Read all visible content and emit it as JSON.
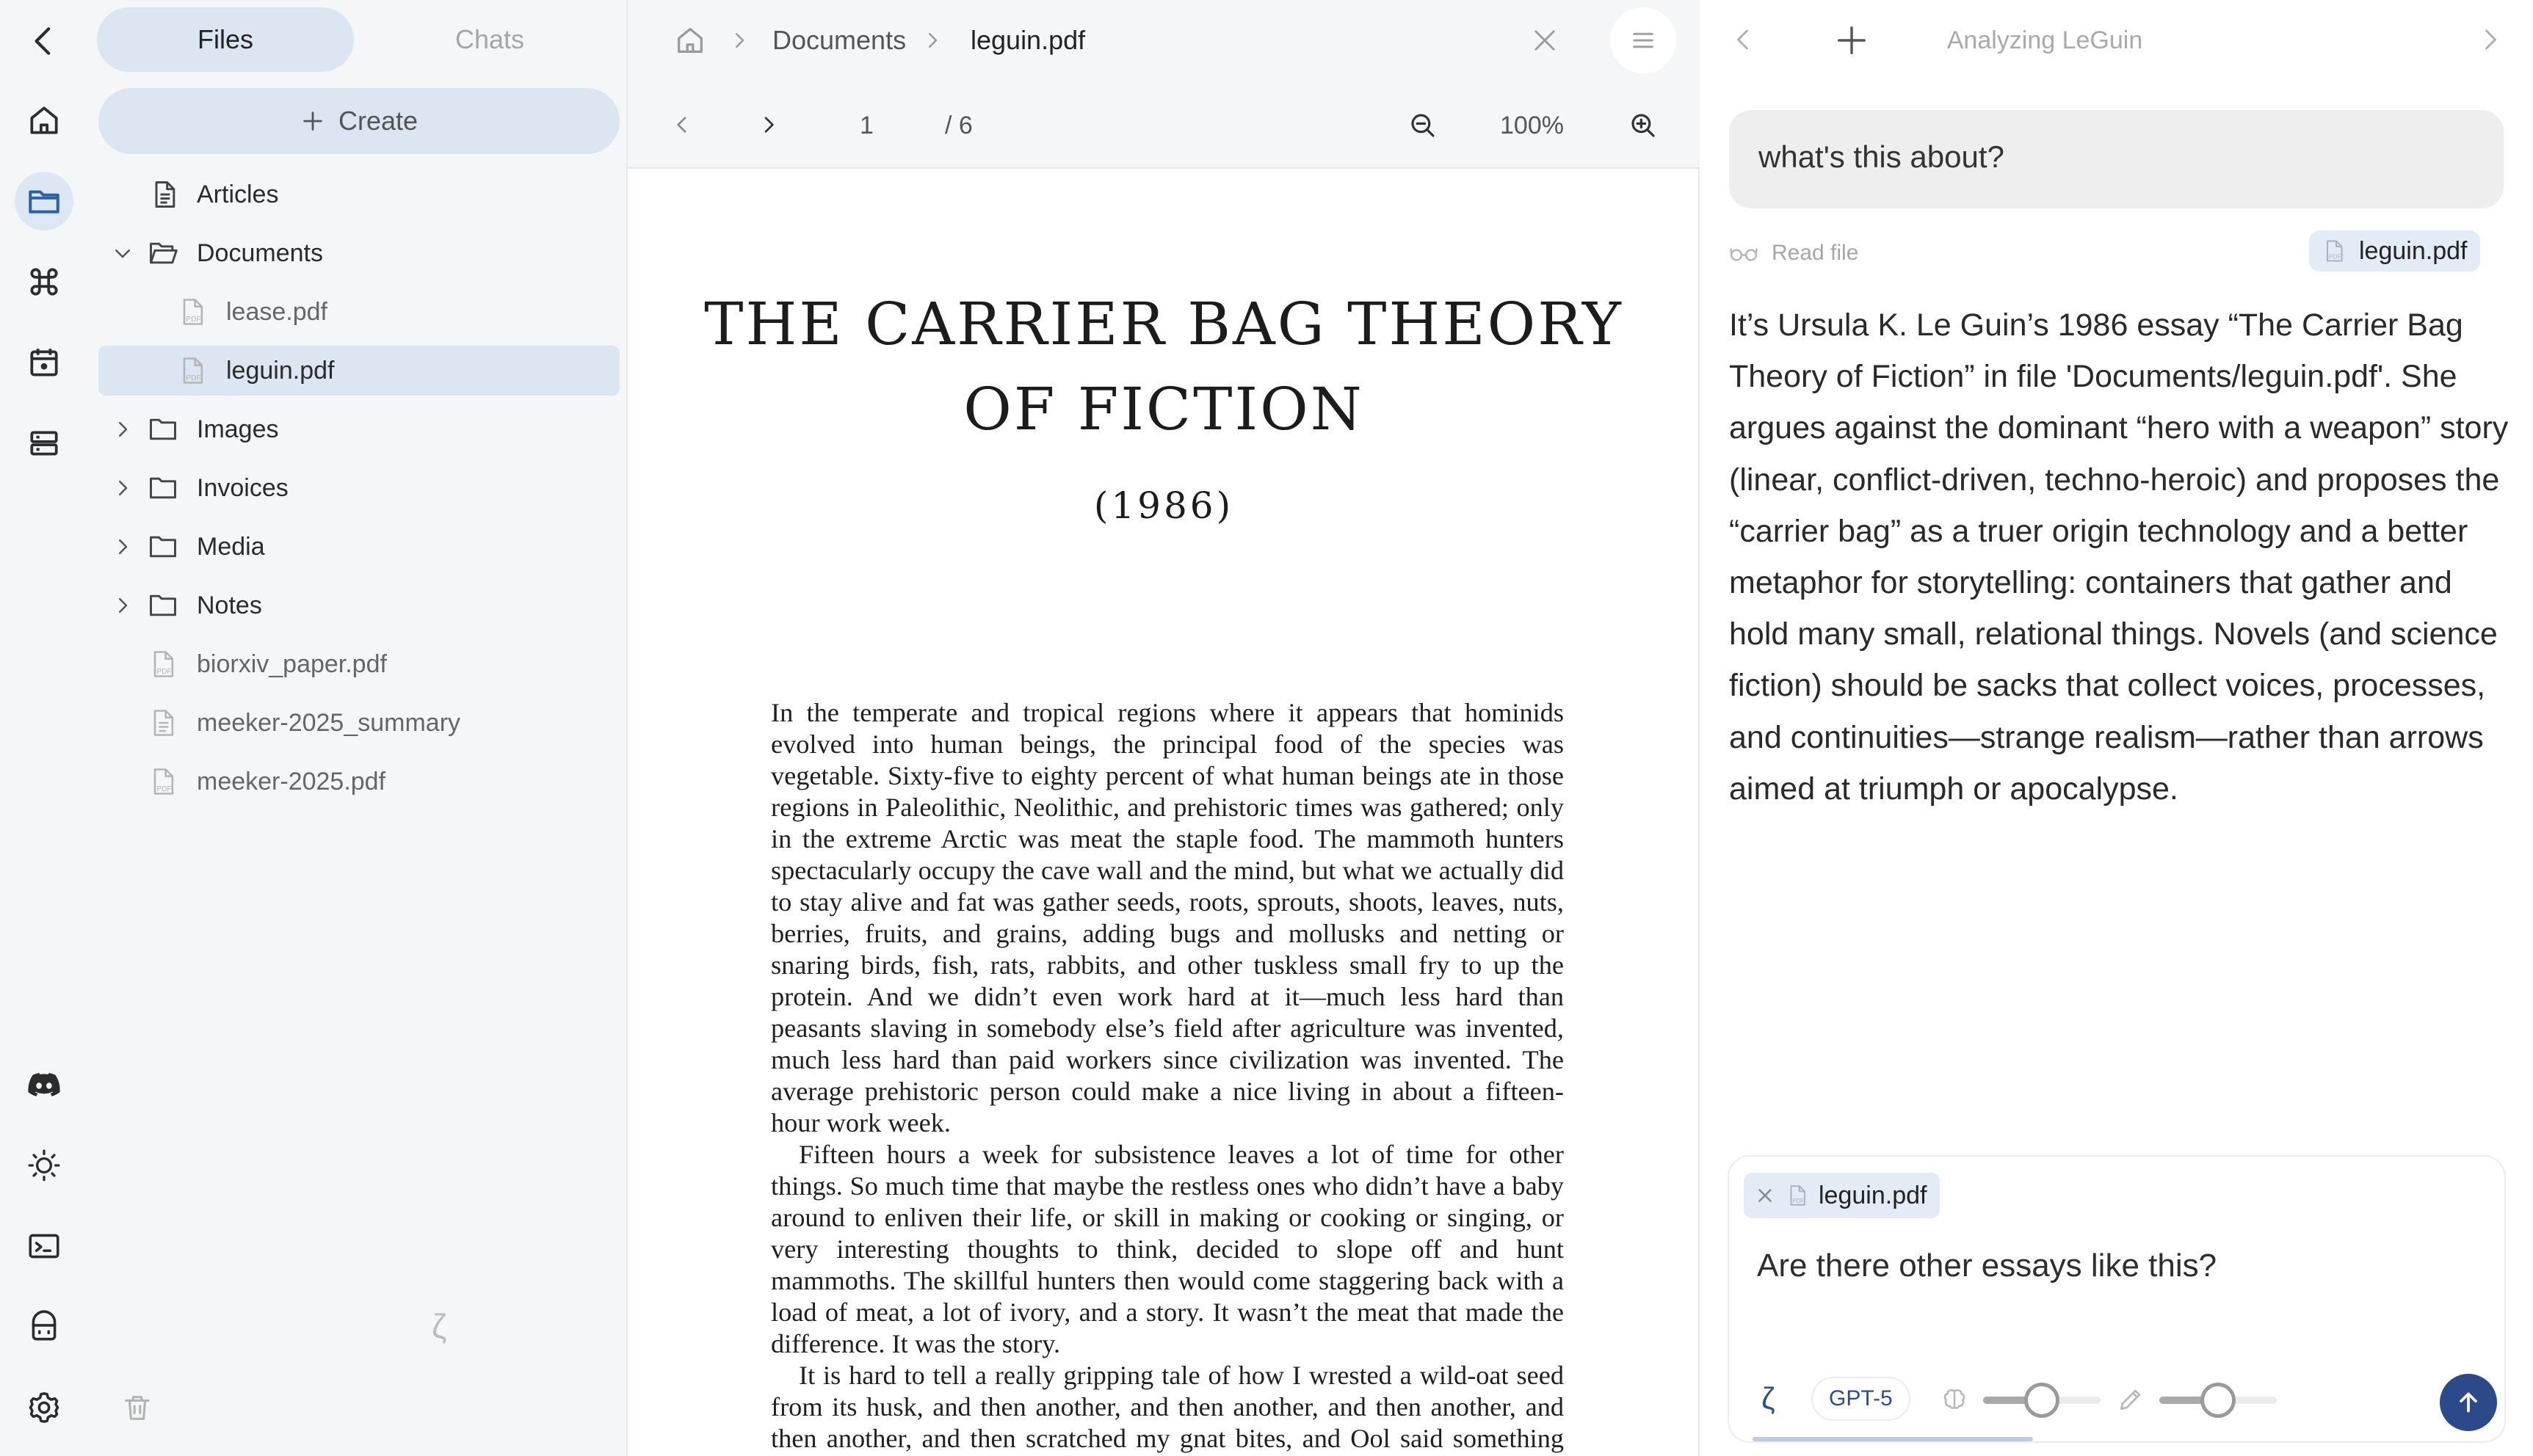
{
  "sidebar": {
    "tabs": {
      "files": "Files",
      "chats": "Chats"
    },
    "create_label": "Create",
    "tree": {
      "articles": "Articles",
      "documents": "Documents",
      "lease": "lease.pdf",
      "leguin": "leguin.pdf",
      "images": "Images",
      "invoices": "Invoices",
      "media": "Media",
      "notes": "Notes",
      "biorxiv": "biorxiv_paper.pdf",
      "meeker_summary": "meeker-2025_summary",
      "meeker_pdf": "meeker-2025.pdf"
    },
    "spinner_glyph": "ζ"
  },
  "viewer": {
    "breadcrumb": {
      "documents": "Documents",
      "file": "leguin.pdf"
    },
    "toolbar": {
      "page": "1",
      "page_total": "/ 6",
      "zoom": "100%"
    },
    "document": {
      "title_line1": "THE CARRIER BAG THEORY",
      "title_line2": "OF FICTION",
      "year": "(1986)",
      "paragraph1": "In the temperate and tropical regions where it appears that hominids evolved into human beings, the principal food of the species was vegetable. Sixty-five to eighty percent of what human beings ate in those regions in Paleolithic, Neolithic, and prehistoric times was gathered; only in the extreme Arctic was meat the staple food. The mammoth hunters spectacularly occupy the cave wall and the mind, but what we actually did to stay alive and fat was gather seeds, roots, sprouts, shoots, leaves, nuts, berries, fruits, and grains, adding bugs and mollusks and netting or snaring birds, fish, rats, rabbits, and other tuskless small fry to up the protein. And we didn’t even work hard at it—much less hard than peasants slaving in somebody else’s field after agriculture was invented, much less hard than paid workers since civilization was invented. The average prehistoric person could make a nice living in about a fifteen-hour work week.",
      "paragraph2": "Fifteen hours a week for subsistence leaves a lot of time for other things. So much time that maybe the restless ones who didn’t have a baby around to enliven their life, or skill in making or cooking or singing, or very interesting thoughts to think, decided to slope off and hunt mammoths. The skillful hunters then would come staggering back with a load of meat, a lot of ivory, and a story. It wasn’t the meat that made the difference. It was the story.",
      "paragraph3": "It is hard to tell a really gripping tale of how I wrested a wild-oat seed from its husk, and then another, and then another, and then another, and then another, and then scratched my gnat bites, and Ool said something funny, and we went to the creek and got a drink and watched newts for a while, and then I found another patch of oats."
    }
  },
  "chat": {
    "title": "Analyzing LeGuin",
    "user_message": "what's this about?",
    "tool_label": "Read file",
    "tool_file": "leguin.pdf",
    "answer": "It’s Ursula K. Le Guin’s 1986 essay “The Carrier Bag Theory of Fiction” in file 'Documents/leguin.pdf'. She argues against the dominant “hero with a weapon” story (linear, conflict-driven, techno-heroic) and proposes the “carrier bag” as a truer origin technology and a better metaphor for storytelling: containers that gather and hold many small, relational things. Novels (and science fiction) should be sacks that collect voices, processes, and continuities—strange realism—rather than arrows aimed at triumph or apocalypse.",
    "composer": {
      "attachment": "leguin.pdf",
      "input_text": "Are there other essays like this?",
      "mode_glyph": "ζ",
      "model": "GPT-5",
      "reasoning_level": 0.5,
      "verbosity_level": 0.5
    }
  },
  "colors": {
    "accent": "#2c4a8a",
    "selection": "#dce5f2",
    "rail_bg": "#f5f6f8"
  }
}
